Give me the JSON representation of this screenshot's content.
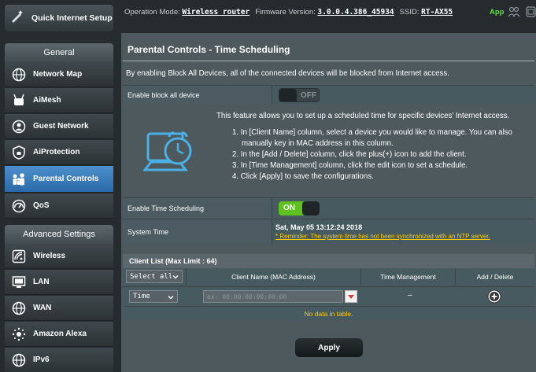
{
  "topbar": {
    "op_mode_label": "Operation Mode:",
    "op_mode_value": "Wireless router",
    "fw_label": "Firmware Version:",
    "fw_value": "3.0.0.4.386_45934",
    "ssid_label": "SSID:",
    "ssid_value": "RT-AX55",
    "app_label": "App"
  },
  "sidebar": {
    "quick_setup": "Quick Internet Setup",
    "general_header": "General",
    "general_items": [
      {
        "label": "Network Map",
        "icon": "globe-icon"
      },
      {
        "label": "AiMesh",
        "icon": "mesh-icon"
      },
      {
        "label": "Guest Network",
        "icon": "guest-icon"
      },
      {
        "label": "AiProtection",
        "icon": "lock-icon"
      },
      {
        "label": "Parental Controls",
        "icon": "family-icon",
        "active": true
      },
      {
        "label": "QoS",
        "icon": "gauge-icon"
      }
    ],
    "advanced_header": "Advanced Settings",
    "advanced_items": [
      {
        "label": "Wireless",
        "icon": "wifi-icon"
      },
      {
        "label": "LAN",
        "icon": "monitor-icon"
      },
      {
        "label": "WAN",
        "icon": "globe-icon"
      },
      {
        "label": "Amazon Alexa",
        "icon": "alexa-icon"
      },
      {
        "label": "IPv6",
        "icon": "globe-icon"
      }
    ]
  },
  "main": {
    "title": "Parental Controls - Time Scheduling",
    "description": "By enabling Block All Devices, all of the connected devices will be blocked from Internet access.",
    "block_all": {
      "label": "Enable block all device",
      "state": "OFF"
    },
    "info": {
      "heading": "This feature allows you to set up a scheduled time for specific devices' Internet access.",
      "steps": [
        "1. In [Client Name] column, select a device you would like to manage. You can also",
        "manually key in MAC address in this column.",
        "2. In the [Add / Delete] column, click the plus(+) icon to add the client.",
        "3. In [Time Management] column, click the edit icon to set a schedule.",
        "4. Click [Apply] to save the configurations."
      ]
    },
    "time_scheduling": {
      "label": "Enable Time Scheduling",
      "state": "ON"
    },
    "system_time": {
      "label": "System Time",
      "value": "Sat, May 05 13:12:24 2018",
      "reminder": "* Reminder: The system time has not been synchronized with an NTP server."
    },
    "client_list": {
      "header": "Client List (Max Limit : 64)",
      "select_all": "Select all",
      "columns": [
        "Client Name (MAC Address)",
        "Time Management",
        "Add / Delete"
      ],
      "row_select": "Time",
      "mac_placeholder": "ex: 00:00:00:00:00:00",
      "time_mgmt_value": "–",
      "no_data": "No data in table."
    },
    "apply_label": "Apply"
  },
  "colors": {
    "accent_on": "#5dc21f",
    "active_nav": "#3a7dbd",
    "warn": "#ffcc00"
  }
}
